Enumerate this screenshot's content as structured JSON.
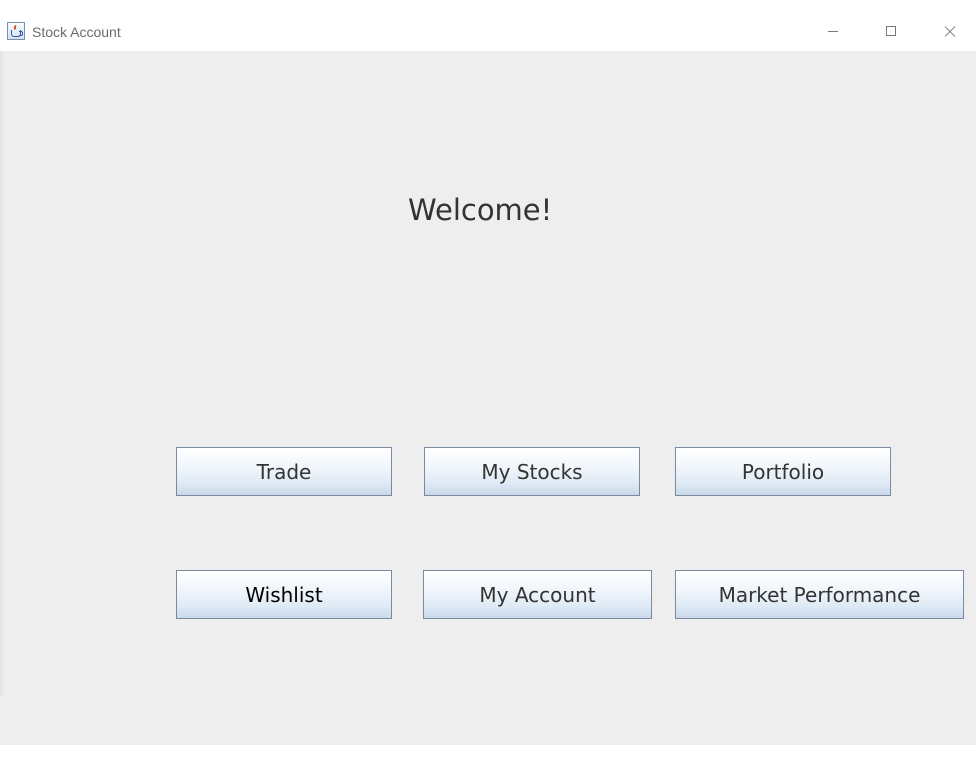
{
  "window": {
    "title": "Stock Account",
    "icon": "java-cup-icon",
    "controls": {
      "minimize": "minimize-icon",
      "maximize": "maximize-icon",
      "close": "close-icon"
    }
  },
  "main": {
    "welcome_text": "Welcome!",
    "buttons": {
      "trade": "Trade",
      "my_stocks": "My Stocks",
      "portfolio": "Portfolio",
      "wishlist": "Wishlist",
      "my_account": "My Account",
      "market_performance": "Market Performance"
    }
  },
  "colors": {
    "background": "#eeeeee",
    "button_border": "#7a8aa0",
    "button_gradient_bottom": "#c9d9ea"
  }
}
